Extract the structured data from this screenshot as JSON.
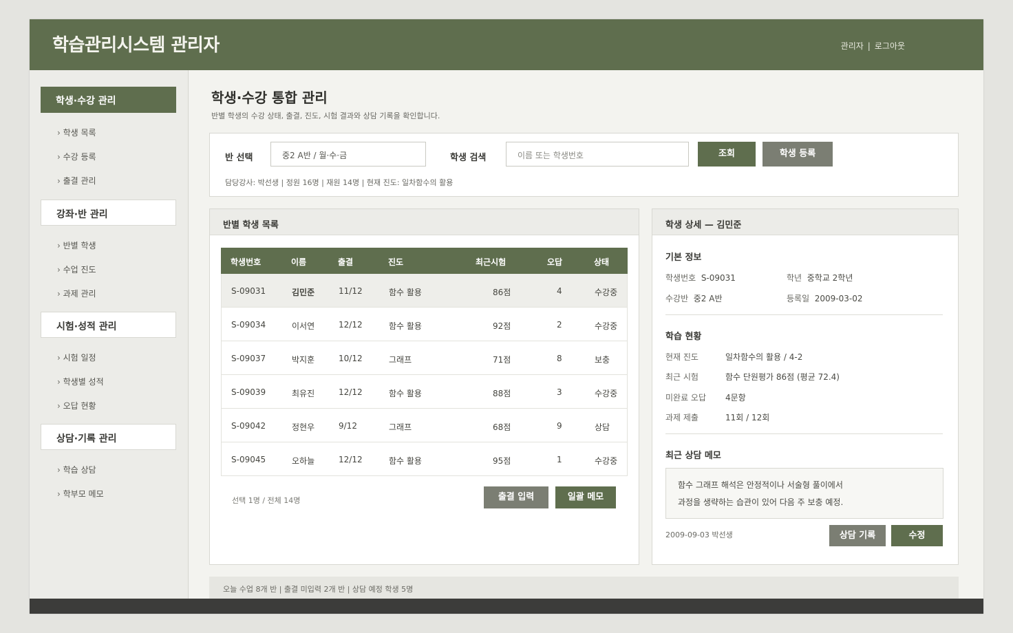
{
  "app": {
    "title": "학습관리시스템 관리자"
  },
  "header": {
    "user": "관리자",
    "separator": "|",
    "logout": "로그아웃"
  },
  "sidebar": {
    "sections": [
      {
        "label": "학생·수강 관리",
        "items": [
          "학생 목록",
          "수강 등록",
          "출결 관리"
        ]
      },
      {
        "label": "강좌·반 관리",
        "items": [
          "반별 학생",
          "수업 진도",
          "과제 관리"
        ]
      },
      {
        "label": "시험·성적 관리",
        "items": [
          "시험 일정",
          "학생별 성적",
          "오답 현황"
        ]
      },
      {
        "label": "상담·기록 관리",
        "items": [
          "학습 상담",
          "학부모 메모"
        ]
      }
    ]
  },
  "page": {
    "title": "학생·수강 통합 관리",
    "description": "반별 학생의 수강 상태, 출결, 진도, 시험 결과와 상담 기록을 확인합니다."
  },
  "filter": {
    "class_label": "반 선택",
    "class_value": "중2 A반 / 월·수·금",
    "search_label": "학생 검색",
    "search_placeholder": "이름 또는 학생번호",
    "search_button": "조회",
    "register_button": "학생 등록",
    "info": "담당강사: 박선생  |  정원 16명  |  재원 14명  |  현재 진도: 일차함수의 활용"
  },
  "student_list": {
    "title": "반별 학생 목록",
    "columns": [
      "학생번호",
      "이름",
      "출결",
      "진도",
      "최근시험",
      "오답",
      "상태"
    ],
    "rows": [
      [
        "S-09031",
        "김민준",
        "11/12",
        "함수 활용",
        "86점",
        "4",
        "수강중"
      ],
      [
        "S-09034",
        "이서연",
        "12/12",
        "함수 활용",
        "92점",
        "2",
        "수강중"
      ],
      [
        "S-09037",
        "박지훈",
        "10/12",
        "그래프",
        "71점",
        "8",
        "보충"
      ],
      [
        "S-09039",
        "최유진",
        "12/12",
        "함수 활용",
        "88점",
        "3",
        "수강중"
      ],
      [
        "S-09042",
        "정현우",
        "9/12",
        "그래프",
        "68점",
        "9",
        "상담"
      ],
      [
        "S-09045",
        "오하늘",
        "12/12",
        "함수 활용",
        "95점",
        "1",
        "수강중"
      ]
    ],
    "footer": "선택 1명 / 전체 14명",
    "attendance_button": "출결 입력",
    "memo_button": "일괄 메모"
  },
  "detail": {
    "title": "학생 상세 — 김민준",
    "basic_title": "기본 정보",
    "student_no_label": "학생번호",
    "student_no": "S-09031",
    "grade_label": "학년",
    "grade": "중학교 2학년",
    "class_label": "수강반",
    "class": "중2 A반",
    "enroll_label": "등록일",
    "enroll_date": "2009-03-02",
    "study_title": "학습 현황",
    "progress_label": "현재 진도",
    "progress": "일차함수의 활용 / 4-2",
    "exam_label": "최근 시험",
    "exam": "함수 단원평가 86점 (평균 72.4)",
    "wrong_label": "미완료 오답",
    "wrong": "4문항",
    "homework_label": "과제 제출",
    "homework": "11회 / 12회",
    "memo_title": "최근 상담 메모",
    "memo_line1": "함수 그래프 해석은 안정적이나 서술형 풀이에서",
    "memo_line2": "과정을 생략하는 습관이 있어 다음 주 보충 예정.",
    "memo_meta": "2009-09-03  박선생",
    "record_button": "상담 기록",
    "edit_button": "수정"
  },
  "statusbar": {
    "text": "오늘 수업 8개 반  |  출결 미입력 2개 반  |  상담 예정 학생 5명"
  },
  "colors": {
    "primary": "#5f6e4e",
    "secondary": "#7b7e73",
    "background": "#f3f3ef",
    "footer": "#3c3c3a"
  }
}
